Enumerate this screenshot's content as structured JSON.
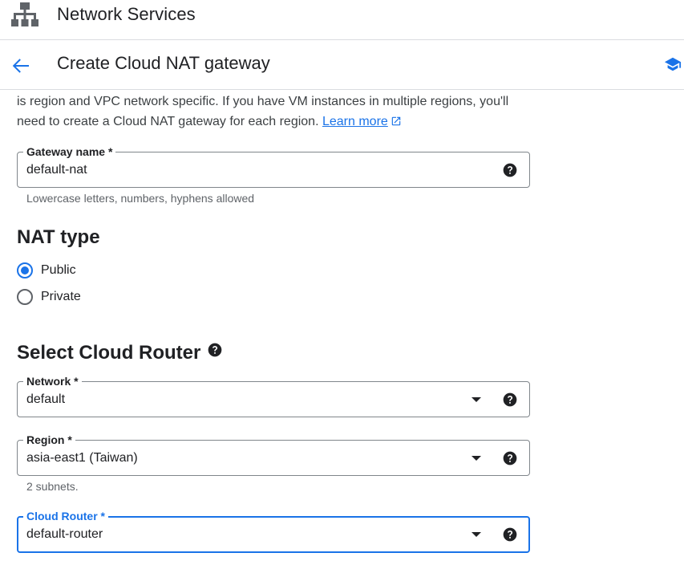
{
  "topbar": {
    "product_icon": "network-topology-icon",
    "product_title": "Network Services"
  },
  "pagebar": {
    "back_icon": "arrow-back-icon",
    "title": "Create Cloud NAT gateway",
    "learn_icon": "school-icon"
  },
  "intro": {
    "text": "is region and VPC network specific. If you have VM instances in multiple regions, you'll need to create a Cloud NAT gateway for each region. ",
    "link_text": "Learn more",
    "link_icon": "open-in-new-icon"
  },
  "gateway_name": {
    "label": "Gateway name *",
    "value": "default-nat",
    "hint": "Lowercase letters, numbers, hyphens allowed",
    "help_icon": "help-icon"
  },
  "nat_type": {
    "heading": "NAT type",
    "options": [
      {
        "label": "Public",
        "checked": true
      },
      {
        "label": "Private",
        "checked": false
      }
    ]
  },
  "cloud_router": {
    "heading": "Select Cloud Router",
    "heading_icon": "help-icon",
    "network": {
      "label": "Network *",
      "value": "default"
    },
    "region": {
      "label": "Region *",
      "value": "asia-east1 (Taiwan)",
      "hint": "2 subnets."
    },
    "router": {
      "label": "Cloud Router *",
      "value": "default-router"
    }
  },
  "colors": {
    "accent": "#1a73e8",
    "text": "#202124",
    "secondary_text": "#5f6368",
    "border": "#80868b",
    "divider": "#dadce0"
  }
}
